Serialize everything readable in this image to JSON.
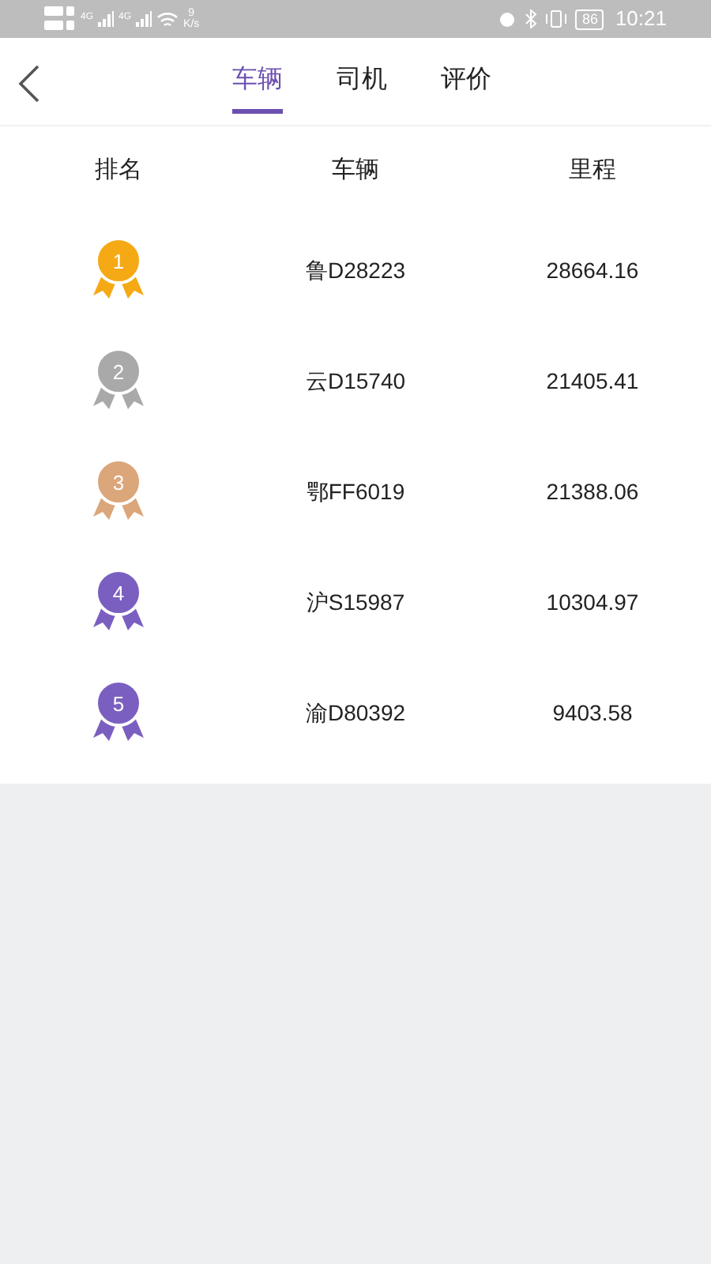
{
  "status_bar": {
    "network_1": "4G",
    "network_2": "4G",
    "speed_value": "9",
    "speed_unit": "K/s",
    "battery": "86",
    "time": "10:21"
  },
  "tabs": [
    {
      "label": "车辆",
      "selected": true
    },
    {
      "label": "司机",
      "selected": false
    },
    {
      "label": "评价",
      "selected": false
    }
  ],
  "table": {
    "columns": [
      "排名",
      "车辆",
      "里程"
    ],
    "rows": [
      {
        "rank": "1",
        "color": "#f5a914",
        "vehicle": "鲁D28223",
        "mileage": "28664.16"
      },
      {
        "rank": "2",
        "color": "#a9a9a9",
        "vehicle": "云D15740",
        "mileage": "21405.41"
      },
      {
        "rank": "3",
        "color": "#dba67a",
        "vehicle": "鄂FF6019",
        "mileage": "21388.06"
      },
      {
        "rank": "4",
        "color": "#7b5fc0",
        "vehicle": "沪S15987",
        "mileage": "10304.97"
      },
      {
        "rank": "5",
        "color": "#7b5fc0",
        "vehicle": "渝D80392",
        "mileage": "9403.58"
      }
    ]
  }
}
